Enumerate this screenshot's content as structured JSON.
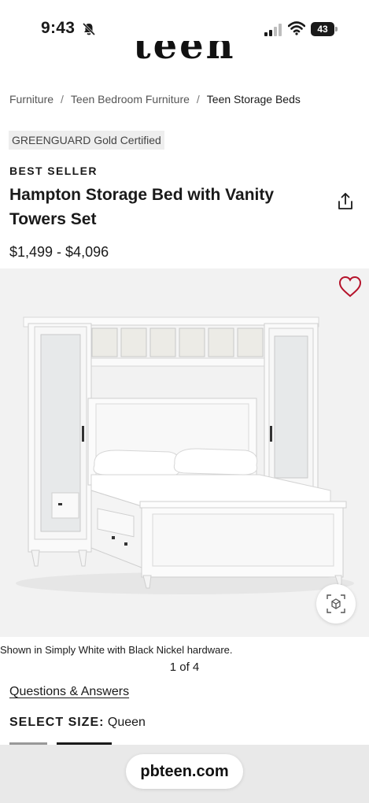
{
  "status_bar": {
    "time": "9:43",
    "battery": "43"
  },
  "logo": {
    "text": "teen"
  },
  "breadcrumb": {
    "items": [
      "Furniture",
      "Teen Bedroom Furniture",
      "Teen Storage Beds"
    ],
    "separator": "/"
  },
  "product": {
    "certification_badge": "GREENGUARD Gold Certified",
    "flag": "BEST SELLER",
    "title": "Hampton Storage Bed with Vanity Towers Set",
    "price": "$1,499 - $4,096"
  },
  "gallery": {
    "caption": "Shown in Simply White with Black Nickel hardware.",
    "counter": "1 of 4"
  },
  "links": {
    "questions": "Questions & Answers"
  },
  "size_selector": {
    "label": "SELECT SIZE:",
    "value": "Queen"
  },
  "browser": {
    "url": "pbteen.com"
  },
  "icons": {
    "favorite": "heart-outline-icon",
    "share": "share-icon",
    "ar": "ar-view-icon",
    "notifications": "bell-off-icon"
  },
  "colors": {
    "accent_heart": "#b5122a",
    "furniture": "#ffffff",
    "image_background": "#f2f2f2"
  }
}
